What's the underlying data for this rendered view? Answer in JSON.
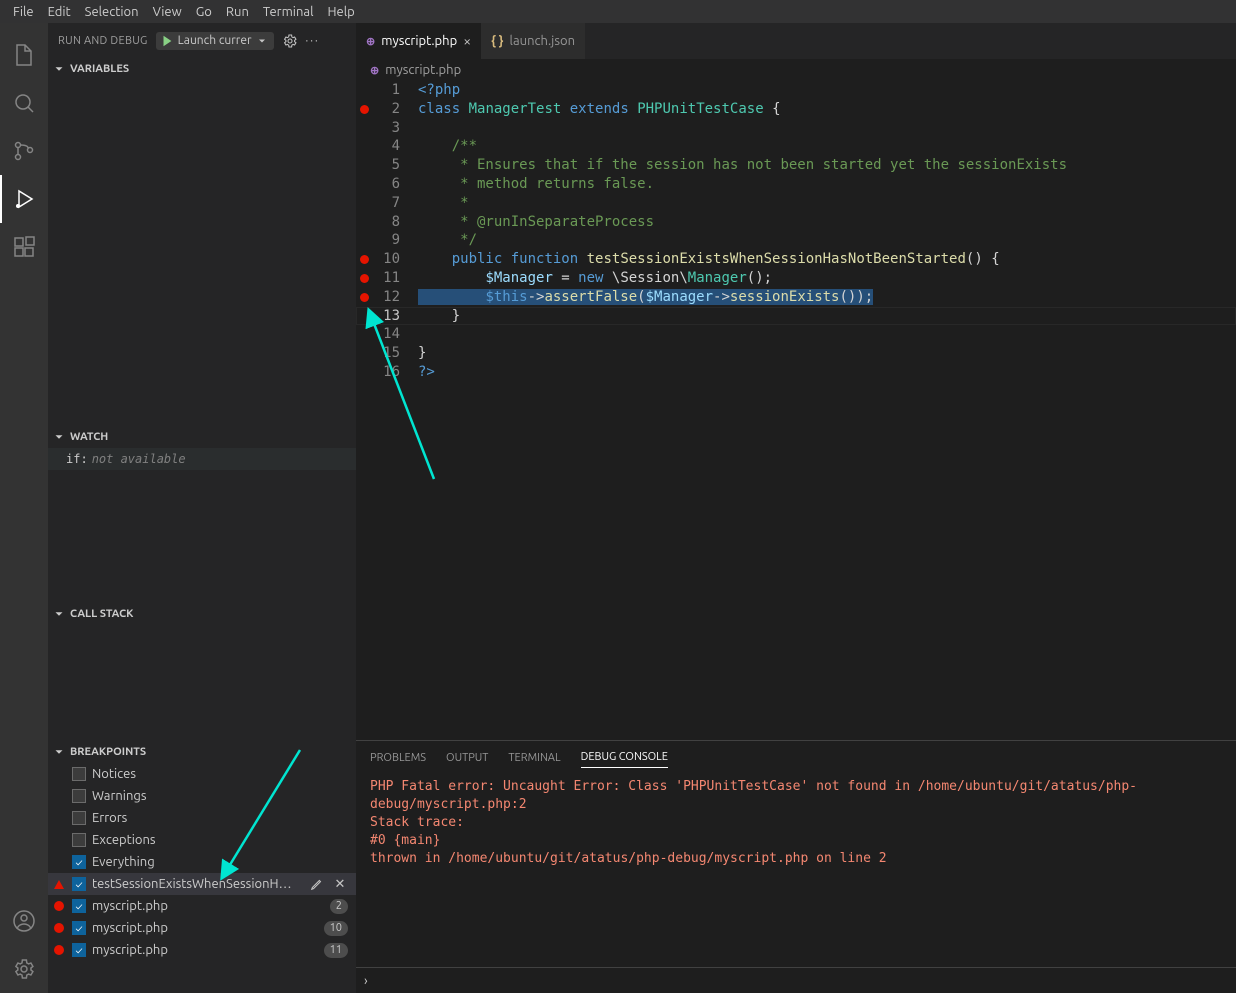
{
  "menu": [
    "File",
    "Edit",
    "Selection",
    "View",
    "Go",
    "Run",
    "Terminal",
    "Help"
  ],
  "sidebar": {
    "title": "RUN AND DEBUG",
    "launch_config": "Launch currer",
    "sections": {
      "variables": "VARIABLES",
      "watch": "WATCH",
      "callstack": "CALL STACK",
      "breakpoints": "BREAKPOINTS"
    },
    "watch_item": {
      "name": "if:",
      "value": "not available"
    },
    "bp_categories": [
      {
        "label": "Notices",
        "checked": false
      },
      {
        "label": "Warnings",
        "checked": false
      },
      {
        "label": "Errors",
        "checked": false
      },
      {
        "label": "Exceptions",
        "checked": false
      },
      {
        "label": "Everything",
        "checked": true
      }
    ],
    "bp_items": [
      {
        "kind": "tri",
        "checked": true,
        "label": "testSessionExistsWhenSessionH…",
        "hover": true
      },
      {
        "kind": "dot",
        "checked": true,
        "label": "myscript.php",
        "badge": "2"
      },
      {
        "kind": "dot",
        "checked": true,
        "label": "myscript.php",
        "badge": "10"
      },
      {
        "kind": "dot",
        "checked": true,
        "label": "myscript.php",
        "badge": "11"
      }
    ]
  },
  "tabs": [
    {
      "icon_color": "#a074c4",
      "icon": "php",
      "label": "myscript.php",
      "active": true,
      "close": true
    },
    {
      "icon_color": "#d7ba7d",
      "icon": "{}",
      "label": "launch.json",
      "active": false,
      "close": false
    }
  ],
  "breadcrumb": {
    "icon_color": "#a074c4",
    "label": "myscript.php"
  },
  "code": {
    "lines": [
      {
        "n": 1,
        "bp": false,
        "html": "<span class=\"c-tag\">&lt;?php</span>"
      },
      {
        "n": 2,
        "bp": true,
        "html": "<span class=\"c-kw\">class</span> <span class=\"c-cls\">ManagerTest</span> <span class=\"c-kw\">extends</span> <span class=\"c-cls\">PHPUnitTestCase</span> {"
      },
      {
        "n": 3,
        "bp": false,
        "html": ""
      },
      {
        "n": 4,
        "bp": false,
        "html": "    <span class=\"c-cmt\">/**</span>"
      },
      {
        "n": 5,
        "bp": false,
        "html": "    <span class=\"c-cmt\"> * Ensures that if the session has not been started yet the sessionExists</span>"
      },
      {
        "n": 6,
        "bp": false,
        "html": "    <span class=\"c-cmt\"> * method returns false.</span>"
      },
      {
        "n": 7,
        "bp": false,
        "html": "    <span class=\"c-cmt\"> *</span>"
      },
      {
        "n": 8,
        "bp": false,
        "html": "    <span class=\"c-cmt\"> * @runInSeparateProcess</span>"
      },
      {
        "n": 9,
        "bp": false,
        "html": "    <span class=\"c-cmt\"> */</span>"
      },
      {
        "n": 10,
        "bp": true,
        "html": "    <span class=\"c-kw\">public</span> <span class=\"c-kw\">function</span> <span class=\"c-fn\">testSessionExistsWhenSessionHasNotBeenStarted</span>() {"
      },
      {
        "n": 11,
        "bp": true,
        "html": "        <span class=\"c-var\">$Manager</span> = <span class=\"c-kw\">new</span> \\Session\\<span class=\"c-cls\">Manager</span>();"
      },
      {
        "n": 12,
        "bp": true,
        "html": "<span class=\"c-sel\">        <span class=\"c-th\">$this</span>-&gt;<span class=\"c-fn\">assertFalse</span>(<span class=\"c-var\">$Manager</span>-&gt;<span class=\"c-fn\">sessionExists</span>());</span>"
      },
      {
        "n": 13,
        "bp": false,
        "cur": true,
        "html": "    }"
      },
      {
        "n": 14,
        "bp": false,
        "html": ""
      },
      {
        "n": 15,
        "bp": false,
        "html": "}"
      },
      {
        "n": 16,
        "bp": false,
        "html": "<span class=\"c-tag\">?&gt;</span>"
      }
    ]
  },
  "panel": {
    "tabs": [
      "PROBLEMS",
      "OUTPUT",
      "TERMINAL",
      "DEBUG CONSOLE"
    ],
    "active": 3,
    "lines": [
      "PHP Fatal error:  Uncaught Error: Class 'PHPUnitTestCase' not found in /home/ubuntu/git/atatus/php-debug/myscript.php:2",
      "Stack trace:",
      "#0 {main}",
      "  thrown in /home/ubuntu/git/atatus/php-debug/myscript.php on line 2"
    ],
    "prompt": "›"
  }
}
